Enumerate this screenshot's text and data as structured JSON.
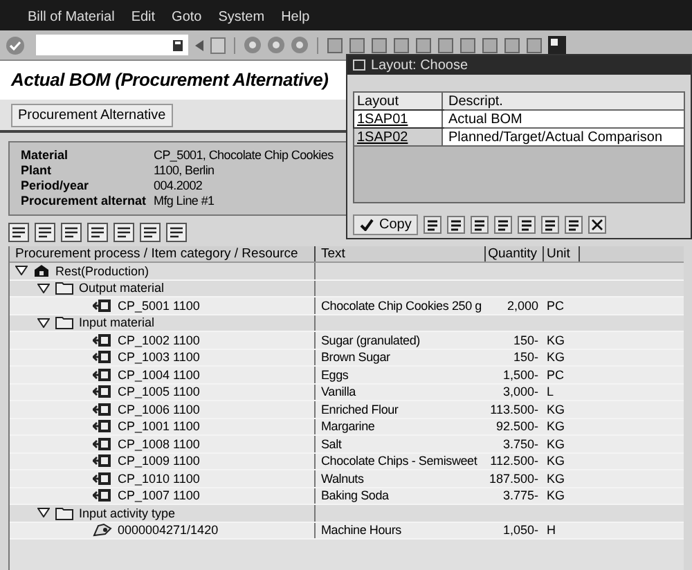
{
  "menu": [
    "Bill of Material",
    "Edit",
    "Goto",
    "System",
    "Help"
  ],
  "title": "Actual BOM (Procurement Alternative)",
  "app_button": "Procurement Alternative",
  "header": [
    {
      "label": "Material",
      "value": "CP_5001, Chocolate Chip Cookies"
    },
    {
      "label": "Plant",
      "value": "1100, Berlin"
    },
    {
      "label": "Period/year",
      "value": "004.2002"
    },
    {
      "label": "Procurement alternat",
      "value": "Mfg Line #1"
    }
  ],
  "table": {
    "columns": [
      "Procurement process / Item category / Resource",
      "Text",
      "Quantity",
      "Unit"
    ],
    "tree": [
      {
        "kind": "root",
        "label": "Rest(Production)",
        "expanded": true,
        "children": [
          {
            "kind": "folder",
            "label": "Output material",
            "expanded": true,
            "children": [
              {
                "kind": "material",
                "label": "CP_5001 1100",
                "text": "Chocolate Chip Cookies 250 g",
                "quantity": "2,000",
                "unit": "PC"
              }
            ]
          },
          {
            "kind": "folder",
            "label": "Input material",
            "expanded": true,
            "children": [
              {
                "kind": "material",
                "label": "CP_1002 1100",
                "text": "Sugar (granulated)",
                "quantity": "150-",
                "unit": "KG"
              },
              {
                "kind": "material",
                "label": "CP_1003 1100",
                "text": "Brown Sugar",
                "quantity": "150-",
                "unit": "KG"
              },
              {
                "kind": "material",
                "label": "CP_1004 1100",
                "text": "Eggs",
                "quantity": "1,500-",
                "unit": "PC"
              },
              {
                "kind": "material",
                "label": "CP_1005 1100",
                "text": "Vanilla",
                "quantity": "3,000-",
                "unit": "L"
              },
              {
                "kind": "material",
                "label": "CP_1006 1100",
                "text": "Enriched Flour",
                "quantity": "113.500-",
                "unit": "KG"
              },
              {
                "kind": "material",
                "label": "CP_1001 1100",
                "text": "Margarine",
                "quantity": "92.500-",
                "unit": "KG"
              },
              {
                "kind": "material",
                "label": "CP_1008 1100",
                "text": "Salt",
                "quantity": "3.750-",
                "unit": "KG"
              },
              {
                "kind": "material",
                "label": "CP_1009 1100",
                "text": "Chocolate Chips - Semisweet",
                "quantity": "112.500-",
                "unit": "KG"
              },
              {
                "kind": "material",
                "label": "CP_1010 1100",
                "text": "Walnuts",
                "quantity": "187.500-",
                "unit": "KG"
              },
              {
                "kind": "material",
                "label": "CP_1007 1100",
                "text": "Baking Soda",
                "quantity": "3.775-",
                "unit": "KG"
              }
            ]
          },
          {
            "kind": "folder",
            "label": "Input activity type",
            "expanded": true,
            "children": [
              {
                "kind": "activity",
                "label": "0000004271/1420",
                "text": "Machine Hours",
                "quantity": "1,050-",
                "unit": "H"
              }
            ]
          }
        ]
      }
    ]
  },
  "popup": {
    "title": "Layout: Choose",
    "columns": [
      "Layout",
      "Descript."
    ],
    "rows": [
      {
        "layout": "1SAP01",
        "description": "Actual BOM",
        "selected": true
      },
      {
        "layout": "1SAP02",
        "description": "Planned/Target/Actual Comparison",
        "selected": false
      }
    ],
    "copy_button": "Copy"
  }
}
